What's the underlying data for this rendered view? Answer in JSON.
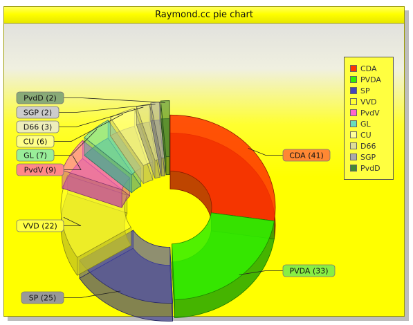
{
  "chart_data": {
    "type": "pie",
    "title": "Raymond.cc pie chart",
    "categories": [
      "CDA",
      "PVDA",
      "SP",
      "VVD",
      "PvdV",
      "GL",
      "CU",
      "D66",
      "SGP",
      "PvdD"
    ],
    "values": [
      41,
      33,
      25,
      22,
      9,
      7,
      6,
      3,
      2,
      2
    ],
    "labels": [
      "CDA (41)",
      "PVDA (33)",
      "SP (25)",
      "VVD (22)",
      "PvdV (9)",
      "GL (7)",
      "CU (6)",
      "D66 (3)",
      "SGP (2)",
      "PvdD (2)"
    ],
    "colors": [
      "#ff3300",
      "#33ee00",
      "#4444bb",
      "#ffff33",
      "#ff66cc",
      "#66ddbb",
      "#ffff99",
      "#dddd99",
      "#aaaaaa",
      "#448833"
    ],
    "label_colors": [
      "#ff8833",
      "#88ee44",
      "#999999",
      "#ffff44",
      "#ff8888",
      "#99ee99",
      "#ffff88",
      "#eeeebb",
      "#cccccc",
      "#88aa77"
    ],
    "legend_placement": "right",
    "style": "3d-donut-exploded"
  }
}
